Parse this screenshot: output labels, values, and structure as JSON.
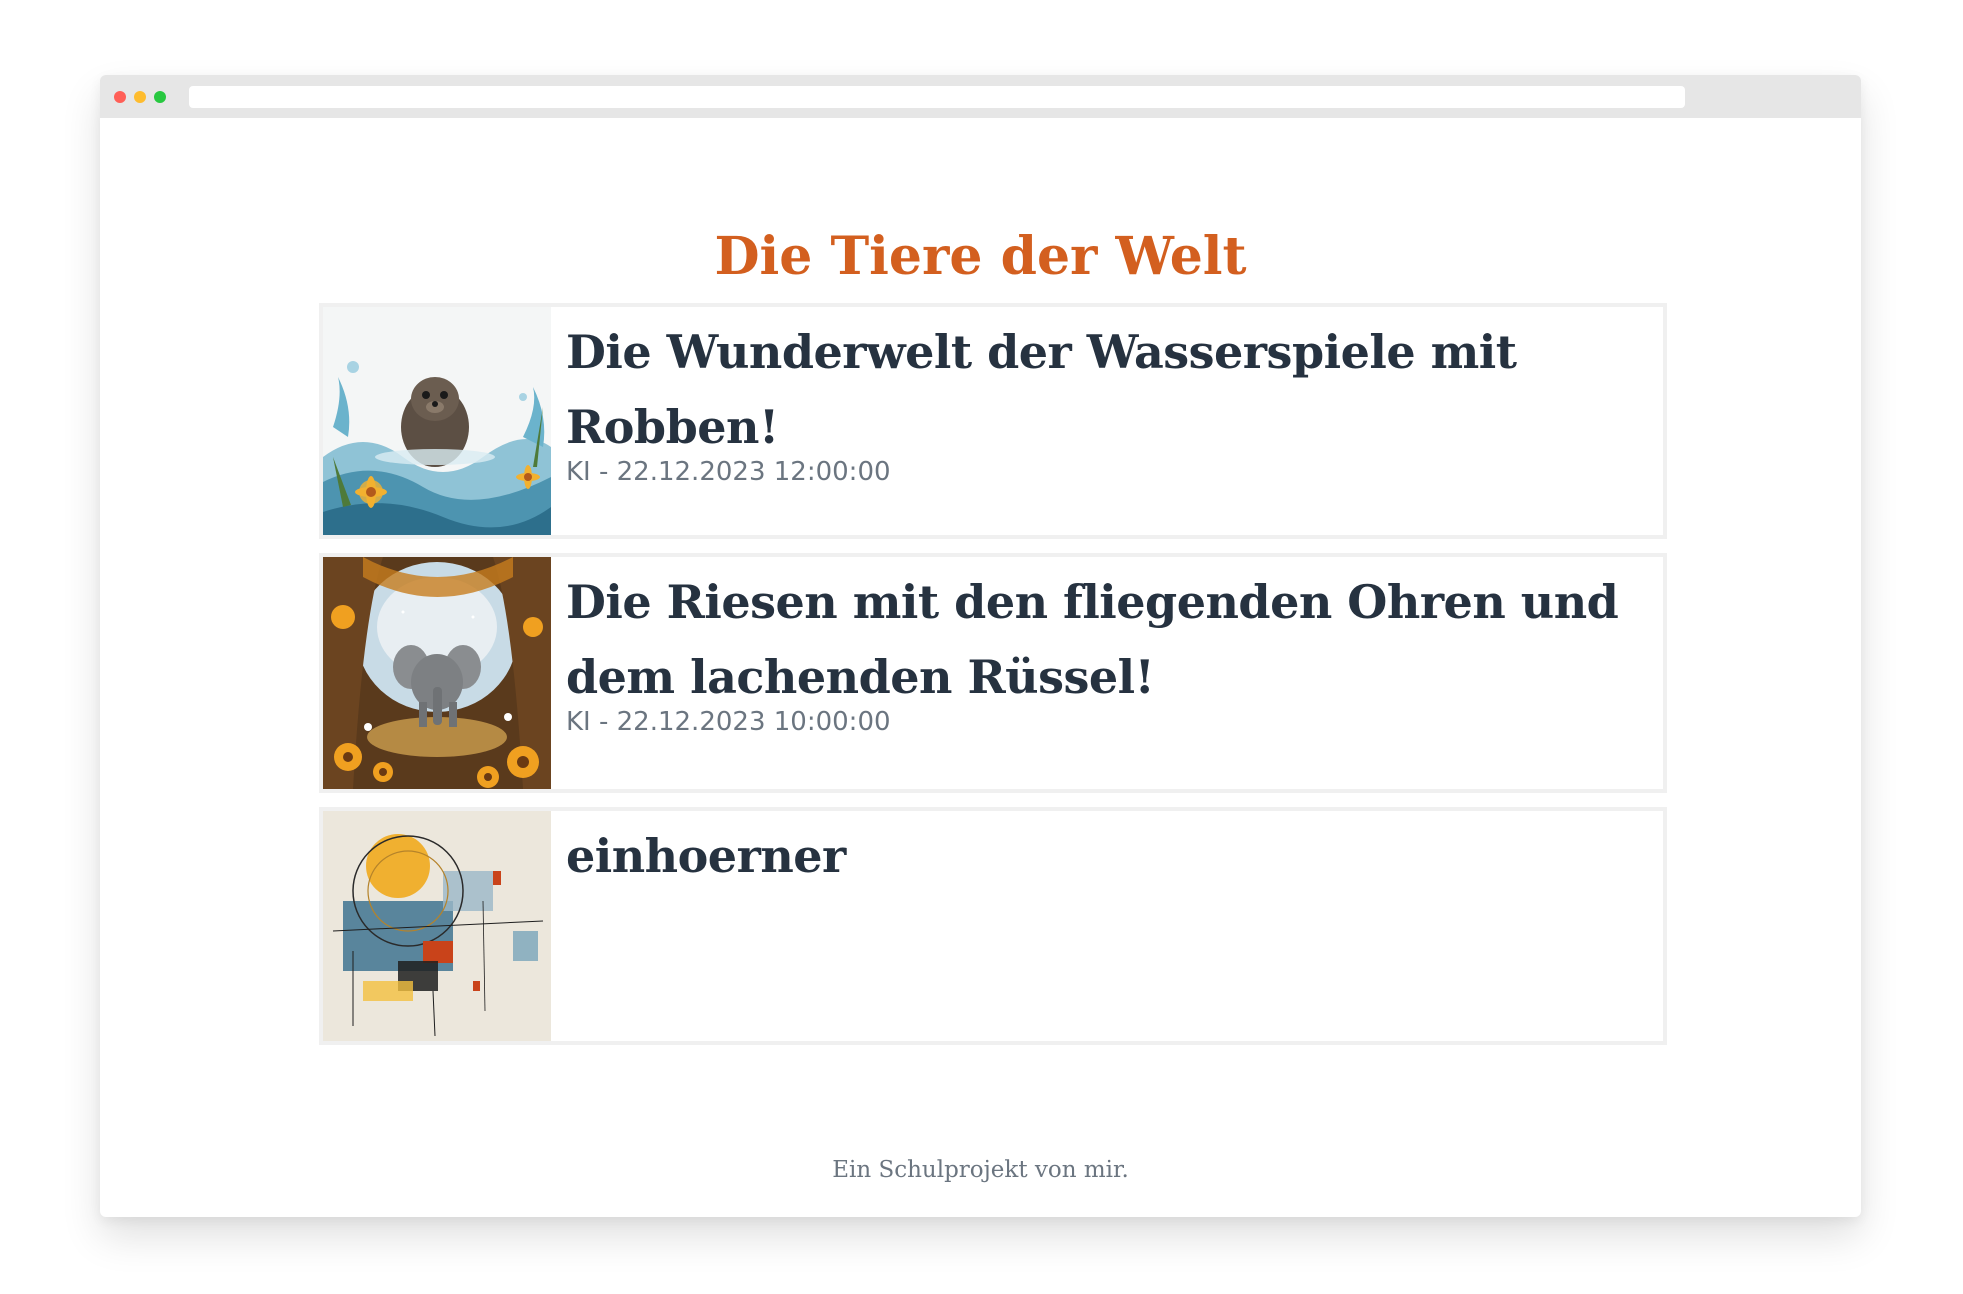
{
  "page": {
    "title": "Die Tiere der Welt",
    "footer": "Ein Schulprojekt von mir."
  },
  "posts": [
    {
      "title": "Die Wunderwelt der Wasserspiele mit Robben!",
      "meta": "KI - 22.12.2023 12:00:00",
      "image_alt": "seal-illustration"
    },
    {
      "title": "Die Riesen mit den fliegenden Ohren und dem lachenden Rüssel!",
      "meta": "KI - 22.12.2023 10:00:00",
      "image_alt": "elephant-illustration"
    },
    {
      "title": "einhoerner",
      "meta": "",
      "image_alt": "abstract-illustration"
    }
  ],
  "colors": {
    "accent": "#d35f1f",
    "heading": "#263240",
    "muted": "#6b7580",
    "card_border": "#f0f0f0"
  }
}
